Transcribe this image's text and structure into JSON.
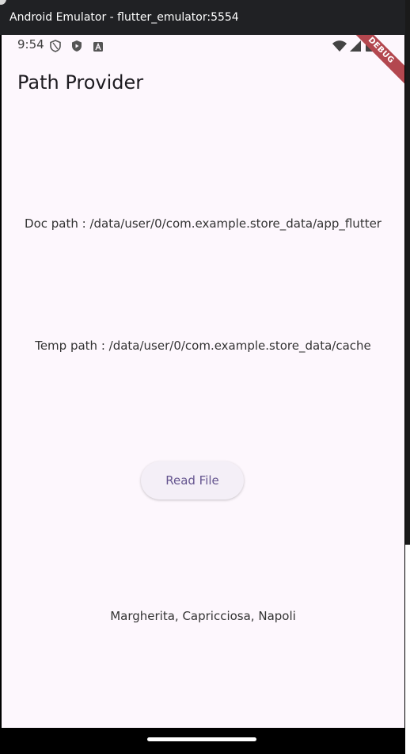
{
  "window": {
    "title": "Android Emulator - flutter_emulator:5554"
  },
  "status_bar": {
    "time": "9:54",
    "left_icons": [
      "shield-icon",
      "play-protect-icon",
      "a-badge-icon"
    ],
    "right_icons": [
      "wifi-icon",
      "signal-icon",
      "battery-icon"
    ]
  },
  "debug_banner": {
    "label": "DEBUG",
    "color": "#b3474f"
  },
  "app_bar": {
    "title": "Path Provider"
  },
  "paths": {
    "doc": "Doc path : /data/user/0/com.example.store_data/app_flutter",
    "temp": "Temp path : /data/user/0/com.example.store_data/cache"
  },
  "actions": {
    "read_file_label": "Read File"
  },
  "file_content": "Margherita, Capricciosa, Napoli",
  "colors": {
    "background": "#fdf7fd",
    "button_text": "#65558f",
    "title_bar": "#202124"
  }
}
